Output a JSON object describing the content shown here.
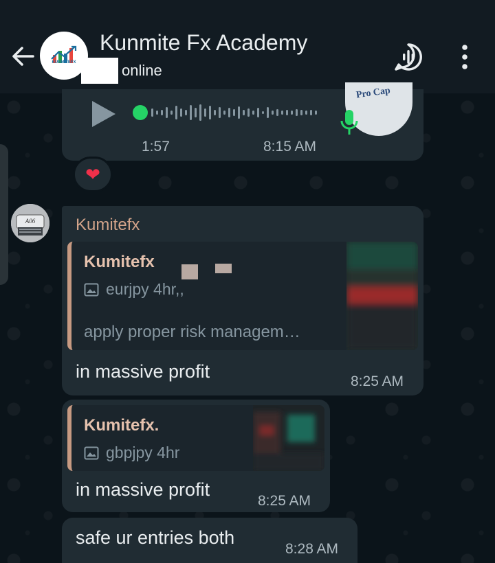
{
  "header": {
    "contact_name": "Kunmite Fx Academy",
    "status": "online",
    "avatar_text": "KUNMITEFX"
  },
  "colors": {
    "background": "#0b141a",
    "header": "#121b22",
    "bubble": "#202c33",
    "accent_green": "#25d366",
    "sender_name": "#d3a48a"
  },
  "voice_message": {
    "duration": "1:57",
    "time": "8:15 AM",
    "thumb_label": "Pro Cap"
  },
  "reaction": {
    "emoji": "❤"
  },
  "message1": {
    "sender": "Kumitefx",
    "quote": {
      "name": "Kumitefx",
      "line1": "eurjpy 4hr,,",
      "line2": "apply proper risk managem…"
    },
    "text": "in  massive profit",
    "time": "8:25 AM"
  },
  "message2": {
    "quote": {
      "name": "Kumitefx.",
      "line1": "gbpjpy 4hr"
    },
    "text": "in massive profit",
    "time": "8:25 AM"
  },
  "message3": {
    "text": "safe ur entries both",
    "time": "8:28 AM"
  }
}
